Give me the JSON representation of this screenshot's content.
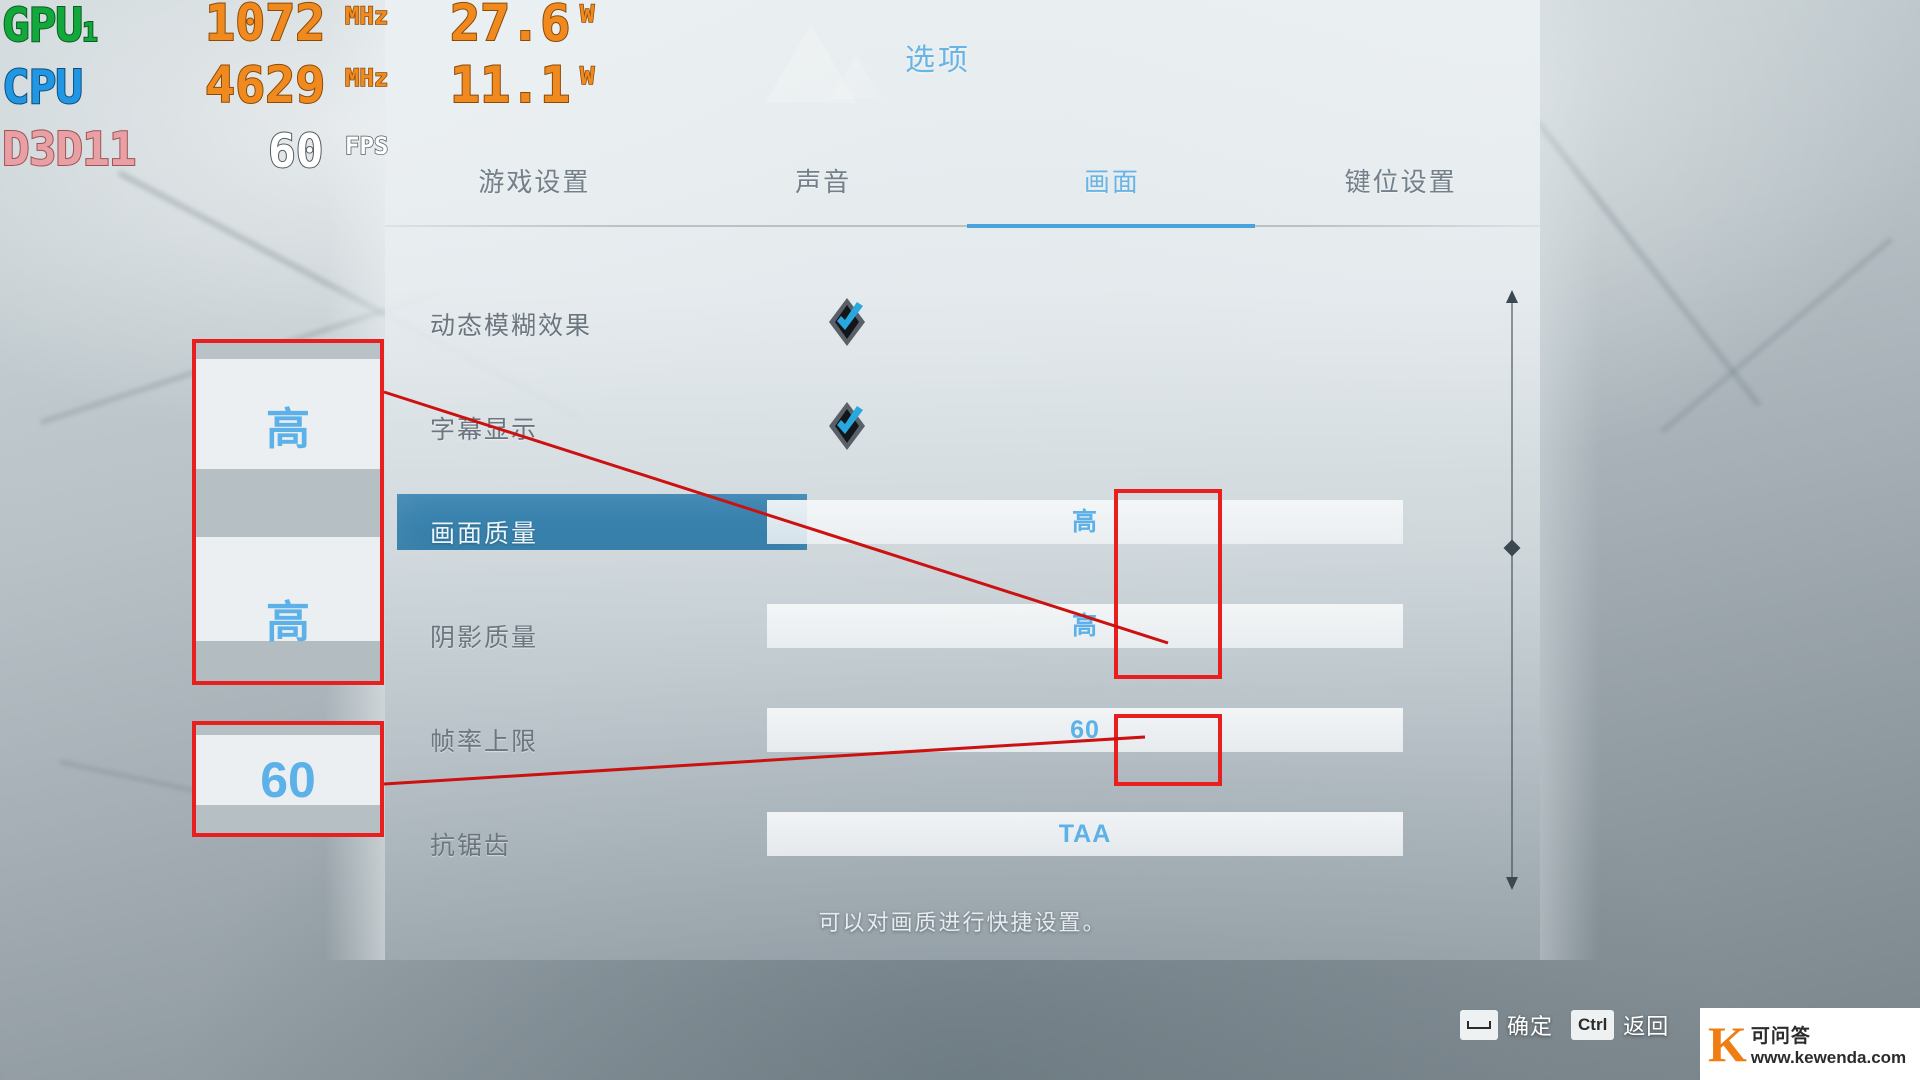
{
  "osd": {
    "rows": [
      {
        "label": "GPU",
        "sub": "1",
        "color": "#13a83c",
        "clock": "1072",
        "clock_unit": "MHz",
        "power": "27.6",
        "power_unit": "W"
      },
      {
        "label": "CPU",
        "sub": "",
        "color": "#2196e3",
        "clock": "4629",
        "clock_unit": "MHz",
        "power": "11.1",
        "power_unit": "W"
      }
    ],
    "api": "D3D11",
    "fps": "60",
    "fps_unit": "FPS"
  },
  "menu": {
    "title": "选项",
    "accent": "#6ab4e4",
    "tabs": [
      {
        "label": "游戏设置",
        "active": false
      },
      {
        "label": "声音",
        "active": false
      },
      {
        "label": "画面",
        "active": true
      },
      {
        "label": "键位设置",
        "active": false
      }
    ],
    "rows": [
      {
        "label": "动态模糊效果",
        "type": "checkbox",
        "checked": true,
        "value": ""
      },
      {
        "label": "字幕显示",
        "type": "checkbox",
        "checked": true,
        "value": ""
      },
      {
        "label": "画面质量",
        "type": "value",
        "selected": true,
        "value": "高"
      },
      {
        "label": "阴影质量",
        "type": "value",
        "selected": false,
        "value": "高"
      },
      {
        "label": "帧率上限",
        "type": "value",
        "selected": false,
        "value": "60"
      },
      {
        "label": "抗锯齿",
        "type": "value",
        "selected": false,
        "value": "TAA"
      }
    ],
    "hint": "可以对画质进行快捷设置。"
  },
  "footer": {
    "items": [
      {
        "key": "space",
        "label": "确定"
      },
      {
        "key": "Ctrl",
        "label": "返回"
      }
    ]
  },
  "callouts": [
    {
      "name": "quality-zoom",
      "values": [
        "高",
        "高"
      ]
    },
    {
      "name": "framerate-zoom",
      "values": [
        "60"
      ]
    }
  ],
  "watermark": {
    "logo_letter": "K",
    "cn": "可问答",
    "url": "www.kewenda.com"
  }
}
